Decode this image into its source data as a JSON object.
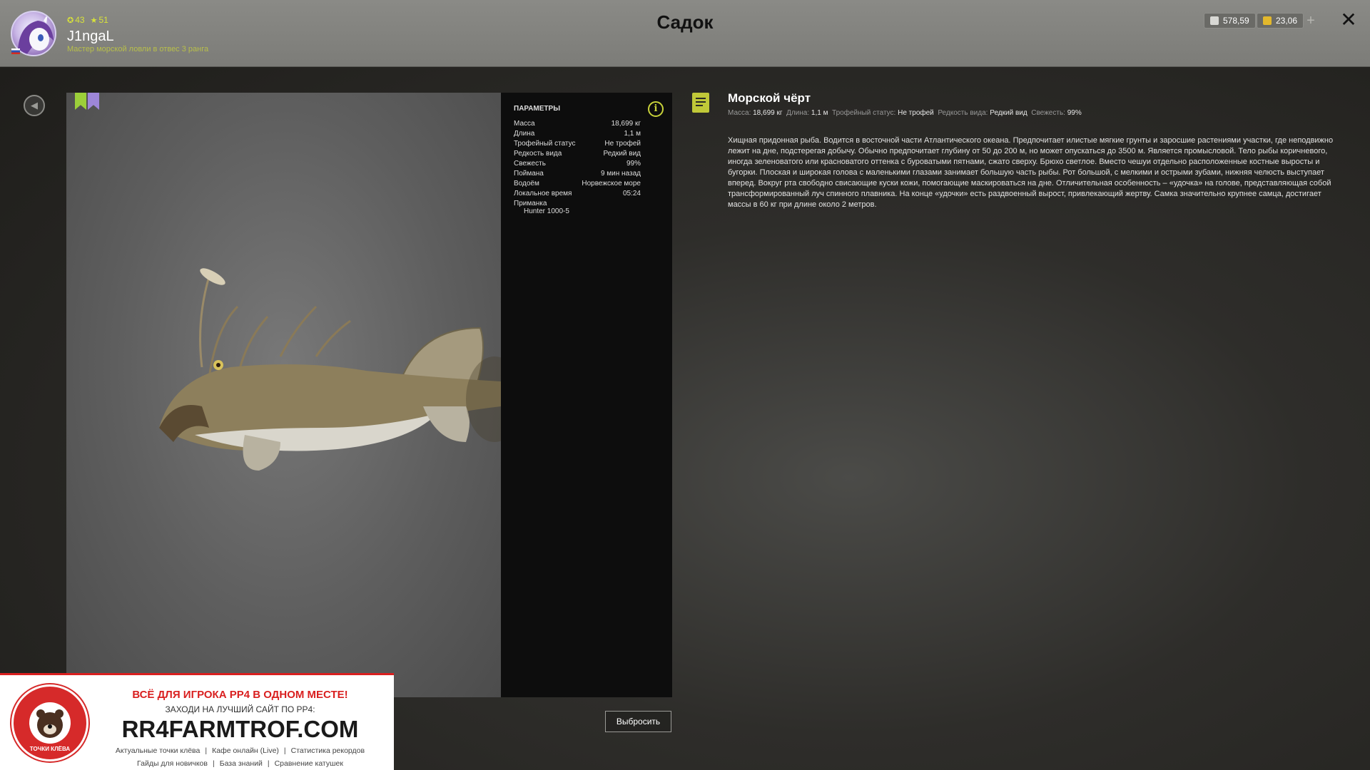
{
  "player": {
    "level": "43",
    "rank_points": "51",
    "nickname": "J1ngaL",
    "rank_title": "Мастер морской ловли в отвес 3 ранга"
  },
  "page_title": "Садок",
  "currency": {
    "silver": "578,59",
    "gold": "23,06",
    "add": "+"
  },
  "close": "✕",
  "params": {
    "title": "ПАРАМЕТРЫ",
    "rows": [
      {
        "label": "Масса",
        "value": "18,699 кг"
      },
      {
        "label": "Длина",
        "value": "1,1 м"
      },
      {
        "label": "Трофейный статус",
        "value": "Не трофей"
      },
      {
        "label": "Редкость вида",
        "value": "Редкий вид"
      },
      {
        "label": "Свежесть",
        "value": "99%"
      },
      {
        "label": "Поймана",
        "value": "9 мин назад"
      },
      {
        "label": "Водоём",
        "value": "Норвежское море"
      },
      {
        "label": "Локальное время",
        "value": "05:24"
      },
      {
        "label": "Приманка",
        "value": ""
      }
    ],
    "bait": "Hunter 1000-5"
  },
  "fish": {
    "name": "Морской чёрт",
    "meta": {
      "mass_label": "Масса:",
      "mass": "18,699 кг",
      "length_label": "Длина:",
      "length": "1,1 м",
      "trophy_label": "Трофейный статус:",
      "trophy": "Не трофей",
      "rarity_label": "Редкость вида:",
      "rarity": "Редкий вид",
      "fresh_label": "Свежесть:",
      "fresh": "99%"
    },
    "description": "Хищная придонная рыба. Водится в восточной части Атлантического океана. Предпочитает илистые мягкие грунты и заросшие растениями участки, где неподвижно лежит на дне, подстерегая добычу. Обычно предпочитает глубину от 50 до 200 м, но может опускаться до 3500 м. Является промысловой. Тело рыбы коричневого, иногда зеленоватого или красноватого оттенка с буроватыми пятнами, сжато сверху. Брюхо светлое. Вместо чешуи отдельно расположенные костные выросты и бугорки. Плоская и широкая голова с маленькими глазами занимает большую часть рыбы. Рот большой, с мелкими и острыми зубами, нижняя челюсть выступает вперед. Вокруг рта свободно свисающие куски кожи, помогающие маскироваться на дне. Отличительная особенность – «удочка» на голове, представляющая собой трансформированный луч спинного плавника. На конце «удочки» есть раздвоенный вырост, привлекающий жертву. Самка значительно крупнее самца, достигает массы в 60 кг при длине около 2 метров."
  },
  "discard_button": "Выбросить",
  "ad": {
    "headline": "ВСЁ ДЛЯ ИГРОКА РР4 В ОДНОМ МЕСТЕ!",
    "subline": "ЗАХОДИ НА ЛУЧШИЙ САЙТ ПО РР4:",
    "site": "RR4FARMTROF.COM",
    "logo_text": "ТОЧКИ КЛЁВА",
    "links_row1": [
      "Актуальные точки клёва",
      "Кафе онлайн (Live)",
      "Статистика рекордов"
    ],
    "links_row2": [
      "Гайды для новичков",
      "База знаний",
      "Сравнение катушек"
    ]
  }
}
